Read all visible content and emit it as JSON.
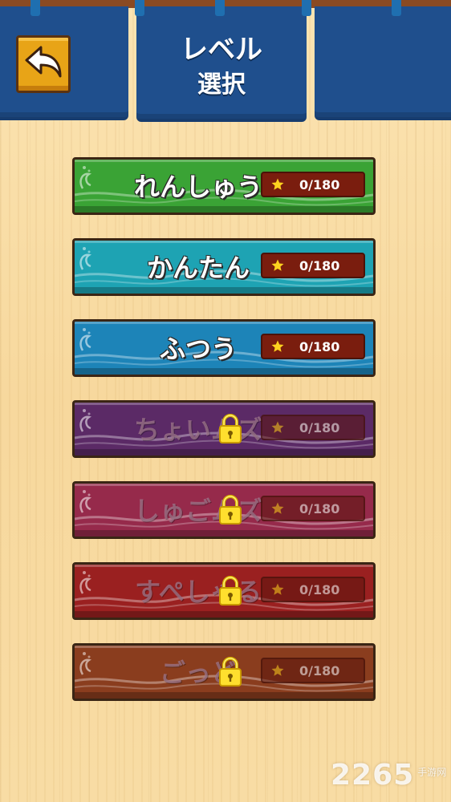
{
  "header": {
    "title_line1": "レベル",
    "title_line2": "選択",
    "back_icon": "back-arrow-icon"
  },
  "levels": [
    {
      "name": "れんしゅう",
      "score": "0/180",
      "locked": false,
      "color": "#3aa335"
    },
    {
      "name": "かんたん",
      "score": "0/180",
      "locked": false,
      "color": "#1ea3b3"
    },
    {
      "name": "ふつう",
      "score": "0/180",
      "locked": false,
      "color": "#1d84b8"
    },
    {
      "name": "ちょいムズ",
      "score": "0/180",
      "locked": true,
      "color": "#5b2a66"
    },
    {
      "name": "しゅごムズ",
      "score": "0/180",
      "locked": true,
      "color": "#962a4b"
    },
    {
      "name": "すぺしゃる",
      "score": "0/180",
      "locked": true,
      "color": "#9a2020"
    },
    {
      "name": "ごっど",
      "score": "0/180",
      "locked": true,
      "color": "#8a3d1e"
    }
  ],
  "watermark": {
    "number": "2265",
    "suffix": "手游网"
  },
  "colors": {
    "curtain": "#1f4f8d",
    "background": "#f8dca4",
    "score_box": "#7a1d0e",
    "star": "#ffd21f"
  }
}
